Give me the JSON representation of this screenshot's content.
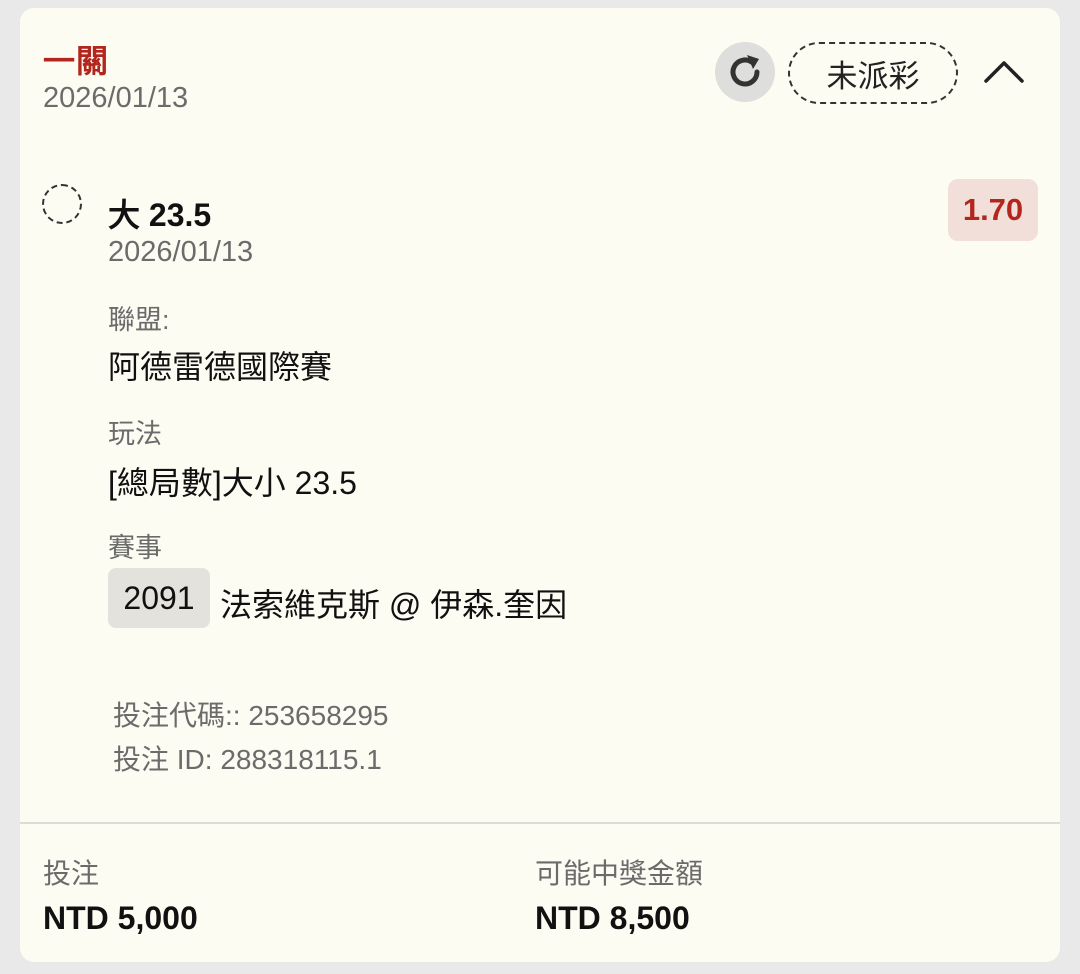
{
  "header": {
    "bet_type": "一關",
    "date": "2026/01/13",
    "status": "未派彩",
    "refresh_icon": "refresh-icon",
    "collapse_icon": "chevron-up-icon"
  },
  "selection": {
    "title": "大 23.5",
    "date": "2026/01/13",
    "odds": "1.70",
    "status_icon": "pending-dashed-circle-icon",
    "league_label": "聯盟:",
    "league_value": "阿德雷德國際賽",
    "market_label": "玩法",
    "market_value": "[總局數]大小 23.5",
    "event_label": "賽事",
    "event_id": "2091",
    "event_name": "法索維克斯 @ 伊森.奎因",
    "bet_code": "投注代碼:: 253658295",
    "bet_id": "投注 ID: 288318115.1"
  },
  "footer": {
    "stake_label": "投注",
    "stake_value": "NTD 5,000",
    "potential_win_label": "可能中獎金額",
    "potential_win_value": "NTD 8,500"
  },
  "colors": {
    "accent_red": "#b3261e",
    "card_bg": "#fdfcf3",
    "odds_bg": "#f2dfd9",
    "muted_text": "#6b6b6b"
  }
}
